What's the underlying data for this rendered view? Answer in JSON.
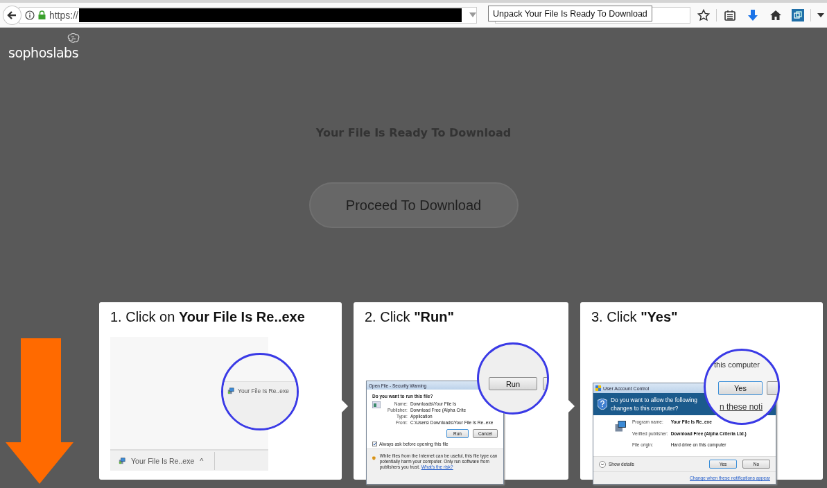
{
  "browser": {
    "url_prefix": "https://",
    "tooltip": "Unpack Your File Is Ready To Download"
  },
  "page": {
    "logo": "sophoslabs",
    "heading": "Your File Is Ready To Download",
    "button": "Proceed To Download"
  },
  "steps": [
    {
      "kind": "download-bar",
      "title": "1. Click on **Your File Is Re..exe**",
      "magnified_file": "Your File Is Re..exe",
      "file": "Your File Is Re..exe",
      "caret": "^"
    },
    {
      "kind": "security-warning",
      "title": "2. Click **\"Run\"**",
      "dialog_title": "Open File - Security Warning",
      "question": "Do you want to run this file?",
      "fields": [
        {
          "label": "Name:",
          "value": "Downloads\\Your File Is"
        },
        {
          "label": "Publisher:",
          "value": "Download Free (Alpha Crite"
        },
        {
          "label": "Type:",
          "value": "Application"
        },
        {
          "label": "From:",
          "value": "C:\\Users\\ Downloads\\Your File Is Re..exe"
        }
      ],
      "buttons": [
        "Run",
        "Cancel"
      ],
      "checkbox": {
        "label": "Always ask before opening this file",
        "checked": true
      },
      "warning": "While files from the Internet can be useful, this file type can potentially harm your computer. Only run software from publishers you trust.",
      "link": "What's the risk?",
      "magnified_button": "Run"
    },
    {
      "kind": "uac",
      "title": "3. Click **\"Yes\"**",
      "dialog_title": "User Account Control",
      "question_lines": [
        "Do you want to allow the following",
        "changes to this computer?"
      ],
      "fields": [
        {
          "label": "Program name:",
          "value": "Your File Is Re..exe"
        },
        {
          "label": "Verified publisher:",
          "value": "Download Free (Alpha Criteria Ltd.)"
        },
        {
          "label": "File origin:",
          "value": "Hard drive on this computer"
        }
      ],
      "details": "Show details",
      "buttons": [
        "Yes",
        "No"
      ],
      "link": "Change when these notifications appear",
      "magnified_text": "this computer",
      "magnified_button": "Yes",
      "magnified_link": "n these noti"
    }
  ]
}
